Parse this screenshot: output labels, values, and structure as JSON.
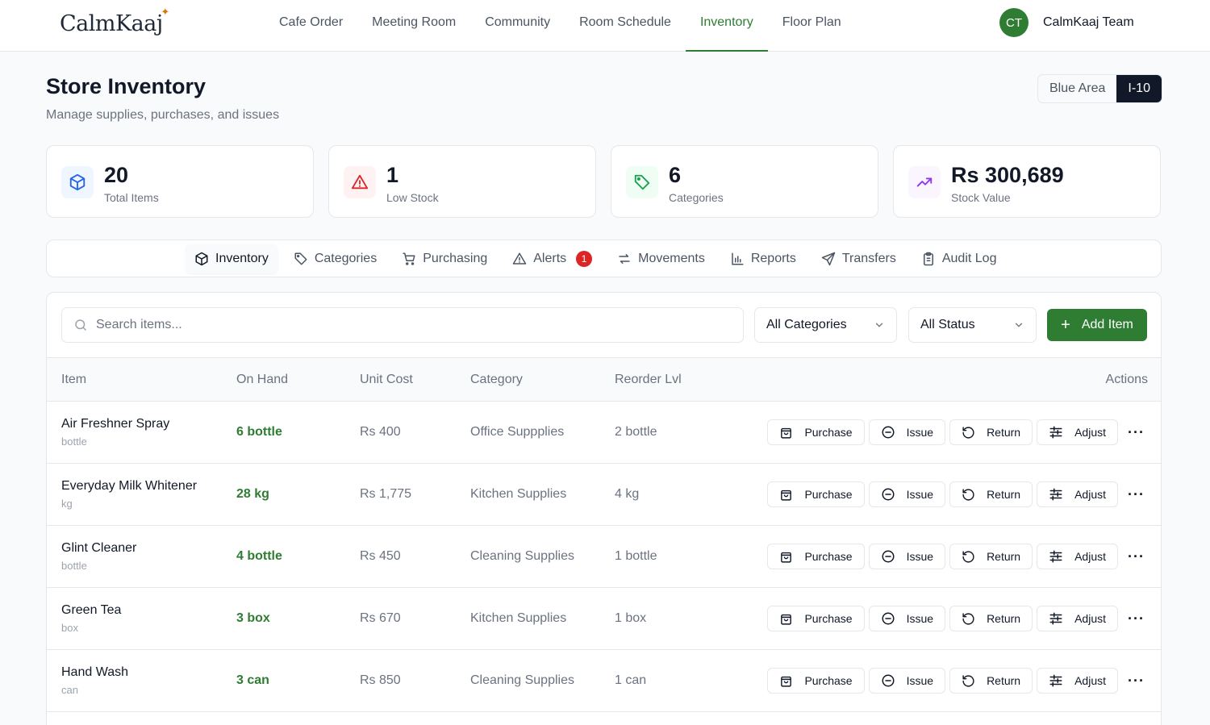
{
  "brand": {
    "name": "CalmKaaj"
  },
  "nav": {
    "links": [
      "Cafe Order",
      "Meeting Room",
      "Community",
      "Room Schedule",
      "Inventory",
      "Floor Plan"
    ],
    "active_index": 4
  },
  "user": {
    "initials": "CT",
    "name": "CalmKaaj Team"
  },
  "page": {
    "title": "Store Inventory",
    "subtitle": "Manage supplies, purchases, and issues"
  },
  "location_switch": {
    "options": [
      "Blue Area",
      "I-10"
    ],
    "selected": "I-10"
  },
  "stats": [
    {
      "value": "20",
      "label": "Total Items",
      "icon": "package-icon",
      "color": "#2563eb",
      "bg": "#eff6ff"
    },
    {
      "value": "1",
      "label": "Low Stock",
      "icon": "alert-triangle-icon",
      "color": "#dc2626",
      "bg": "#fef2f2"
    },
    {
      "value": "6",
      "label": "Categories",
      "icon": "tag-icon",
      "color": "#16a34a",
      "bg": "#f0fdf4"
    },
    {
      "value": "Rs 300,689",
      "label": "Stock Value",
      "icon": "trending-up-icon",
      "color": "#9333ea",
      "bg": "#faf5ff"
    }
  ],
  "tabs": [
    {
      "label": "Inventory",
      "icon": "package-icon"
    },
    {
      "label": "Categories",
      "icon": "tag-icon"
    },
    {
      "label": "Purchasing",
      "icon": "cart-icon"
    },
    {
      "label": "Alerts",
      "icon": "alert-triangle-icon",
      "badge": "1"
    },
    {
      "label": "Movements",
      "icon": "arrows-icon"
    },
    {
      "label": "Reports",
      "icon": "bar-chart-icon"
    },
    {
      "label": "Transfers",
      "icon": "send-icon"
    },
    {
      "label": "Audit Log",
      "icon": "clipboard-icon"
    }
  ],
  "active_tab": "Inventory",
  "filters": {
    "search_placeholder": "Search items...",
    "category": "All Categories",
    "status": "All Status",
    "add_label": "Add Item"
  },
  "table": {
    "headers": [
      "Item",
      "On Hand",
      "Unit Cost",
      "Category",
      "Reorder Lvl",
      "Actions"
    ],
    "action_labels": [
      "Purchase",
      "Issue",
      "Return",
      "Adjust"
    ],
    "rows": [
      {
        "name": "Air Freshner Spray",
        "unit": "bottle",
        "on_hand": "6 bottle",
        "unit_cost": "Rs 400",
        "category": "Office Suppplies",
        "reorder": "2 bottle"
      },
      {
        "name": "Everyday Milk Whitener",
        "unit": "kg",
        "on_hand": "28 kg",
        "unit_cost": "Rs 1,775",
        "category": "Kitchen Supplies",
        "reorder": "4 kg"
      },
      {
        "name": "Glint Cleaner",
        "unit": "bottle",
        "on_hand": "4 bottle",
        "unit_cost": "Rs 450",
        "category": "Cleaning Supplies",
        "reorder": "1 bottle"
      },
      {
        "name": "Green Tea",
        "unit": "box",
        "on_hand": "3 box",
        "unit_cost": "Rs 670",
        "category": "Kitchen Supplies",
        "reorder": "1 box"
      },
      {
        "name": "Hand Wash",
        "unit": "can",
        "on_hand": "3 can",
        "unit_cost": "Rs 850",
        "category": "Cleaning Supplies",
        "reorder": "1 can"
      }
    ]
  },
  "colors": {
    "accent": "#2e7d32",
    "dark": "#111827",
    "danger": "#dc2626"
  }
}
